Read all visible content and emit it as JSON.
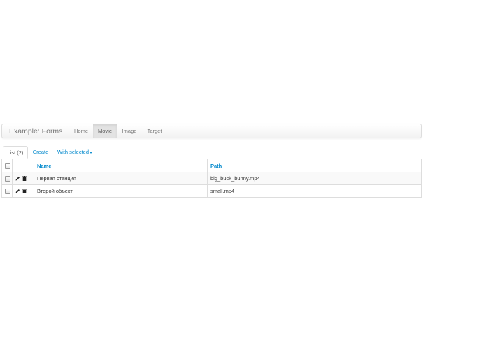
{
  "navbar": {
    "brand": "Example: Forms",
    "items": [
      {
        "label": "Home",
        "active": false
      },
      {
        "label": "Movie",
        "active": true
      },
      {
        "label": "Image",
        "active": false
      },
      {
        "label": "Target",
        "active": false
      }
    ]
  },
  "tabs": {
    "list_label": "List (2)",
    "create_label": "Create",
    "with_selected_label": "With selected"
  },
  "table": {
    "columns": [
      "Name",
      "Path"
    ],
    "rows": [
      {
        "name": "Первая станция",
        "path": "big_buck_bunny.mp4"
      },
      {
        "name": "Второй объект",
        "path": "small.mp4"
      }
    ]
  },
  "icons": {
    "edit": "pencil-icon",
    "delete": "trash-icon"
  },
  "colors": {
    "link": "#0088cc",
    "muted": "#777777",
    "border": "#dddddd",
    "stripe": "#f9f9f9"
  }
}
